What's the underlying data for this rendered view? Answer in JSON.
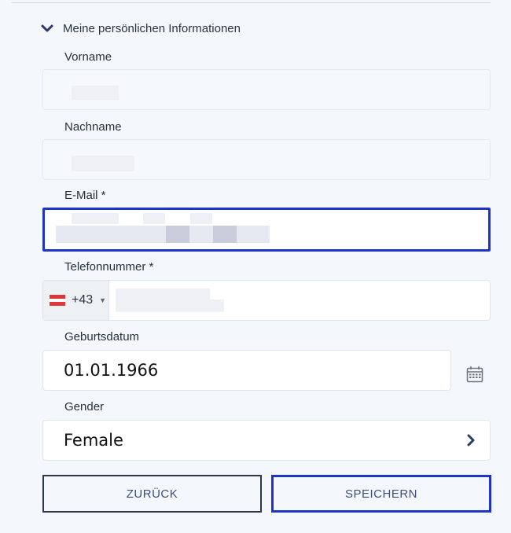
{
  "section": {
    "title": "Meine persönlichen Informationen"
  },
  "fields": {
    "first_name": {
      "label": "Vorname",
      "value": ""
    },
    "last_name": {
      "label": "Nachname",
      "value": ""
    },
    "email": {
      "label": "E-Mail *",
      "value": ""
    },
    "phone": {
      "label": "Telefonnummer *",
      "country_code": "+43",
      "country": "Austria",
      "value": ""
    },
    "birthdate": {
      "label": "Geburtsdatum",
      "value": "01.01.1966"
    },
    "gender": {
      "label": "Gender",
      "value": "Female"
    }
  },
  "buttons": {
    "back": "ZURÜCK",
    "save": "SPEICHERN"
  },
  "colors": {
    "accent": "#1f36c4",
    "button_text": "#3d4d80",
    "icon": "#2d3a6b",
    "flag_red": "#e0363a"
  },
  "icons": [
    "chevron-down-icon",
    "calendar-icon",
    "chevron-right-icon",
    "austria-flag-icon",
    "caret-down-icon"
  ]
}
